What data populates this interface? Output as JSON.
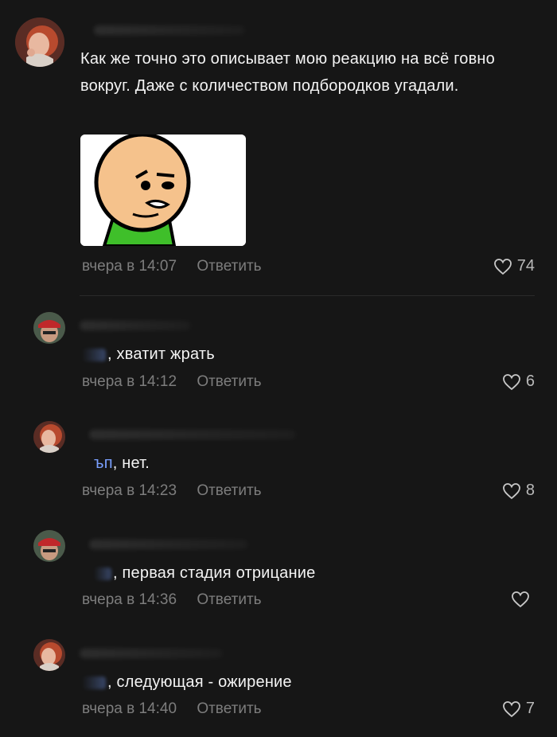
{
  "comments": [
    {
      "text": "Как же точно это описывает мою реакцию на всё говно вокруг. Даже с количеством подбородков угадали.",
      "time": "вчера в 14:07",
      "reply": "Ответить",
      "likes": "74",
      "has_image": true
    },
    {
      "text": ", хватит жрать",
      "time": "вчера в 14:12",
      "reply": "Ответить",
      "likes": "6"
    },
    {
      "text": ", нет.",
      "visible_mention_fragment": "ъп",
      "time": "вчера в 14:23",
      "reply": "Ответить",
      "likes": "8"
    },
    {
      "text": ", первая стадия отрицание",
      "time": "вчера в 14:36",
      "reply": "Ответить",
      "likes": ""
    },
    {
      "text": ", следующая - ожирение",
      "time": "вчера в 14:40",
      "reply": "Ответить",
      "likes": "7"
    }
  ],
  "icons": {
    "like": "heart-outline-icon",
    "avatar_a": "avatar-redhead-woman",
    "avatar_b": "avatar-man-red-cap"
  },
  "colors": {
    "background": "#161616",
    "text": "#f4f4f4",
    "meta": "#7d7d7d",
    "mention": "#7aa0ff"
  }
}
